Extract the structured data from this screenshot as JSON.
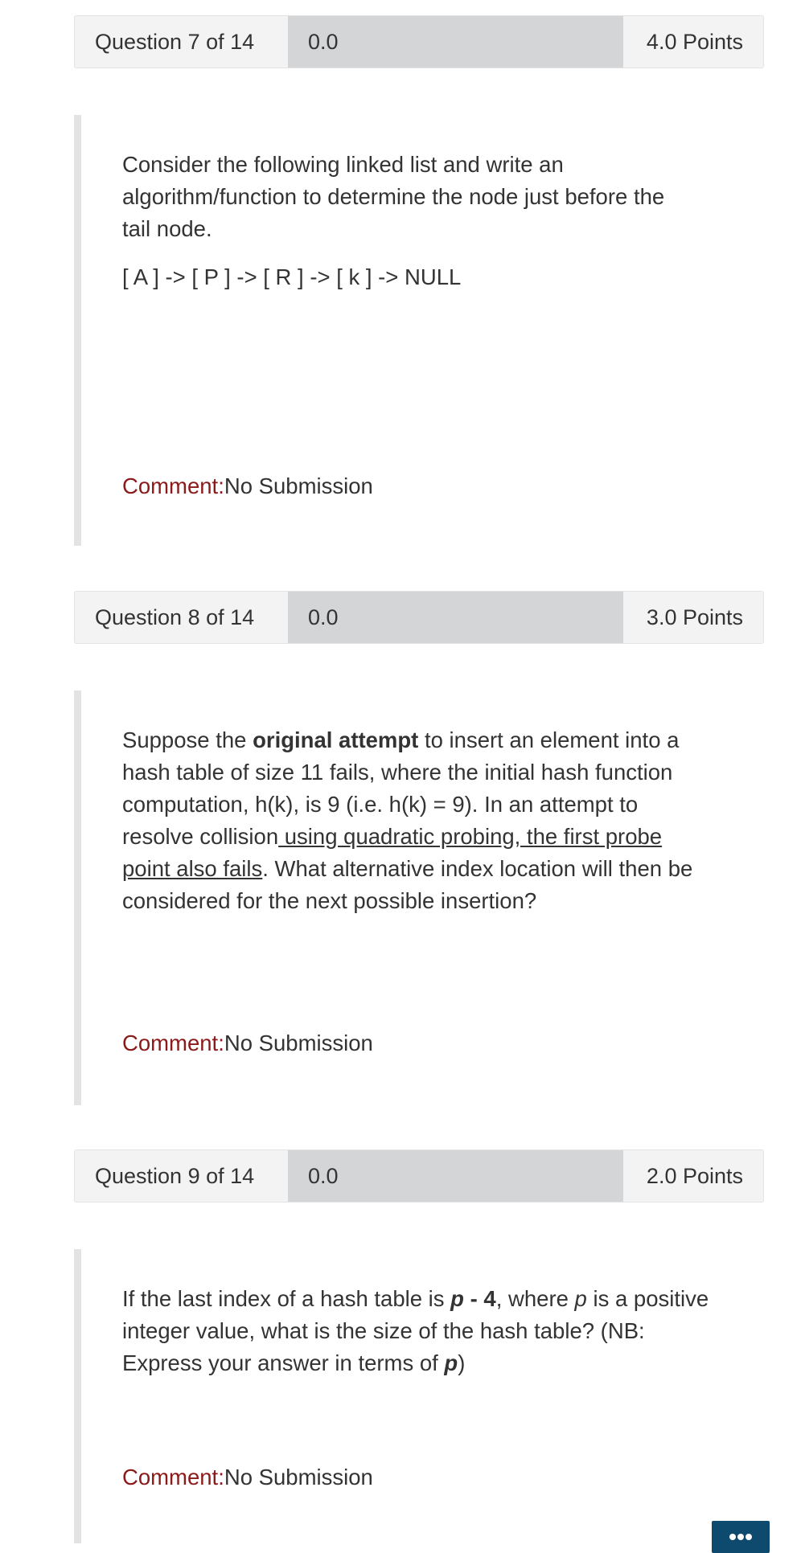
{
  "questions": [
    {
      "header": {
        "label": "Question 7 of 14",
        "score": "0.0",
        "points": "4.0 Points"
      },
      "text": {
        "p1": "Consider the following linked list and write an algorithm/function to determine the node just before the tail node.",
        "p2": "[ A ]  -> [ P ] -> [ R ] -> [ k ] -> NULL"
      },
      "comment": {
        "label": "Comment:",
        "value": "No Submission"
      }
    },
    {
      "header": {
        "label": "Question 8 of 14",
        "score": "0.0",
        "points": "3.0 Points"
      },
      "text": {
        "s1": "Suppose the ",
        "s2": "original attempt",
        "s3": " to insert an element into a hash table of size 11 fails, where the initial hash function computation, h(k), is 9 (i.e. h(k) = 9). In an attempt to resolve collision",
        "s4": " using quadratic probing, the first probe point also fails",
        "s5": ". What alternative index location will then be considered for the next possible insertion?"
      },
      "comment": {
        "label": "Comment:",
        "value": "No Submission"
      }
    },
    {
      "header": {
        "label": "Question 9 of 14",
        "score": "0.0",
        "points": "2.0 Points"
      },
      "text": {
        "s1": "If the last index of a hash table is ",
        "s2": "p",
        "s3": " - 4",
        "s4": ", where ",
        "s5": "p",
        "s6": "  is a positive integer value, what is the size of the hash table? (NB: Express your answer in terms of ",
        "s7": "p",
        "s8": ")"
      },
      "comment": {
        "label": "Comment:",
        "value": "No Submission"
      }
    }
  ],
  "colors": {
    "header_bg": "#f3f3f3",
    "score_bg": "#d4d5d7",
    "comment_label": "#8b1a1a",
    "fab_bg": "#0d4a6e"
  },
  "icons": {
    "fab": "more-dots-icon"
  }
}
